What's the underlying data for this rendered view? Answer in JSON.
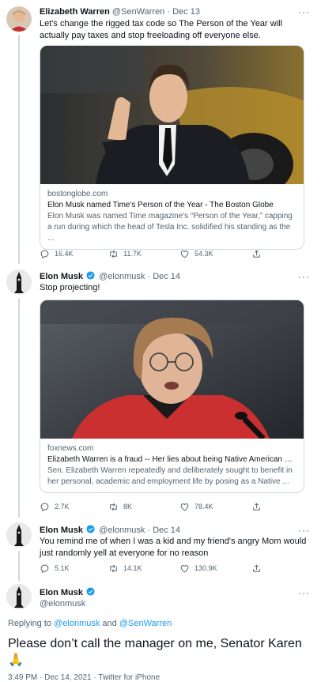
{
  "tweets": [
    {
      "name": "Elizabeth Warren",
      "handle": "@SenWarren",
      "date": "Dec 13",
      "text": "Let's change the rigged tax code so The Person of the Year will actually pay taxes and stop freeloading off everyone else.",
      "card": {
        "domain": "bostonglobe.com",
        "title": "Elon Musk named Time's Person of the Year - The Boston Globe",
        "description": "Elon Musk was named Time magazine's “Person of the Year,” capping a run during which the head of Tesla Inc. solidified his standing as the ..."
      },
      "stats": {
        "replies": "16.4K",
        "retweets": "11.7K",
        "likes": "54.3K"
      }
    },
    {
      "name": "Elon Musk",
      "handle": "@elonmusk",
      "date": "Dec 14",
      "text": "Stop projecting!",
      "card": {
        "domain": "foxnews.com",
        "title": "Elizabeth Warren is a fraud -- Her lies about being Native American di...",
        "description": "Sen. Elizabeth Warren repeatedly and deliberately sought to benefit in her personal, academic and employment life by posing as a Native ..."
      },
      "stats": {
        "replies": "2.7K",
        "retweets": "8K",
        "likes": "78.4K"
      }
    },
    {
      "name": "Elon Musk",
      "handle": "@elonmusk",
      "date": "Dec 14",
      "text": "You remind me of when I was a kid and my friend's angry Mom would just randomly yell at everyone for no reason",
      "stats": {
        "replies": "5.1K",
        "retweets": "14.1K",
        "likes": "130.9K"
      }
    }
  ],
  "main_tweet": {
    "name": "Elon Musk",
    "handle": "@elonmusk",
    "replying_prefix": "Replying to",
    "replying_user1": "@elonmusk",
    "replying_and": "and",
    "replying_user2": "@SenWarren",
    "text": "Please don’t call the manager on me, Senator Karen",
    "emoji": "🙏",
    "timestamp": "3:49 PM · Dec 14, 2021 · Twitter for iPhone"
  },
  "ui": {
    "dot": "·",
    "more": "···"
  },
  "colors": {
    "accent": "#1d9bf0",
    "secondary_text": "#536471",
    "border": "#cfd9de",
    "verified": "#1d9bf0"
  },
  "icons": {
    "reply": "reply-icon",
    "retweet": "retweet-icon",
    "like": "heart-icon",
    "share": "share-icon",
    "verified": "verified-badge-icon",
    "more": "more-icon"
  }
}
